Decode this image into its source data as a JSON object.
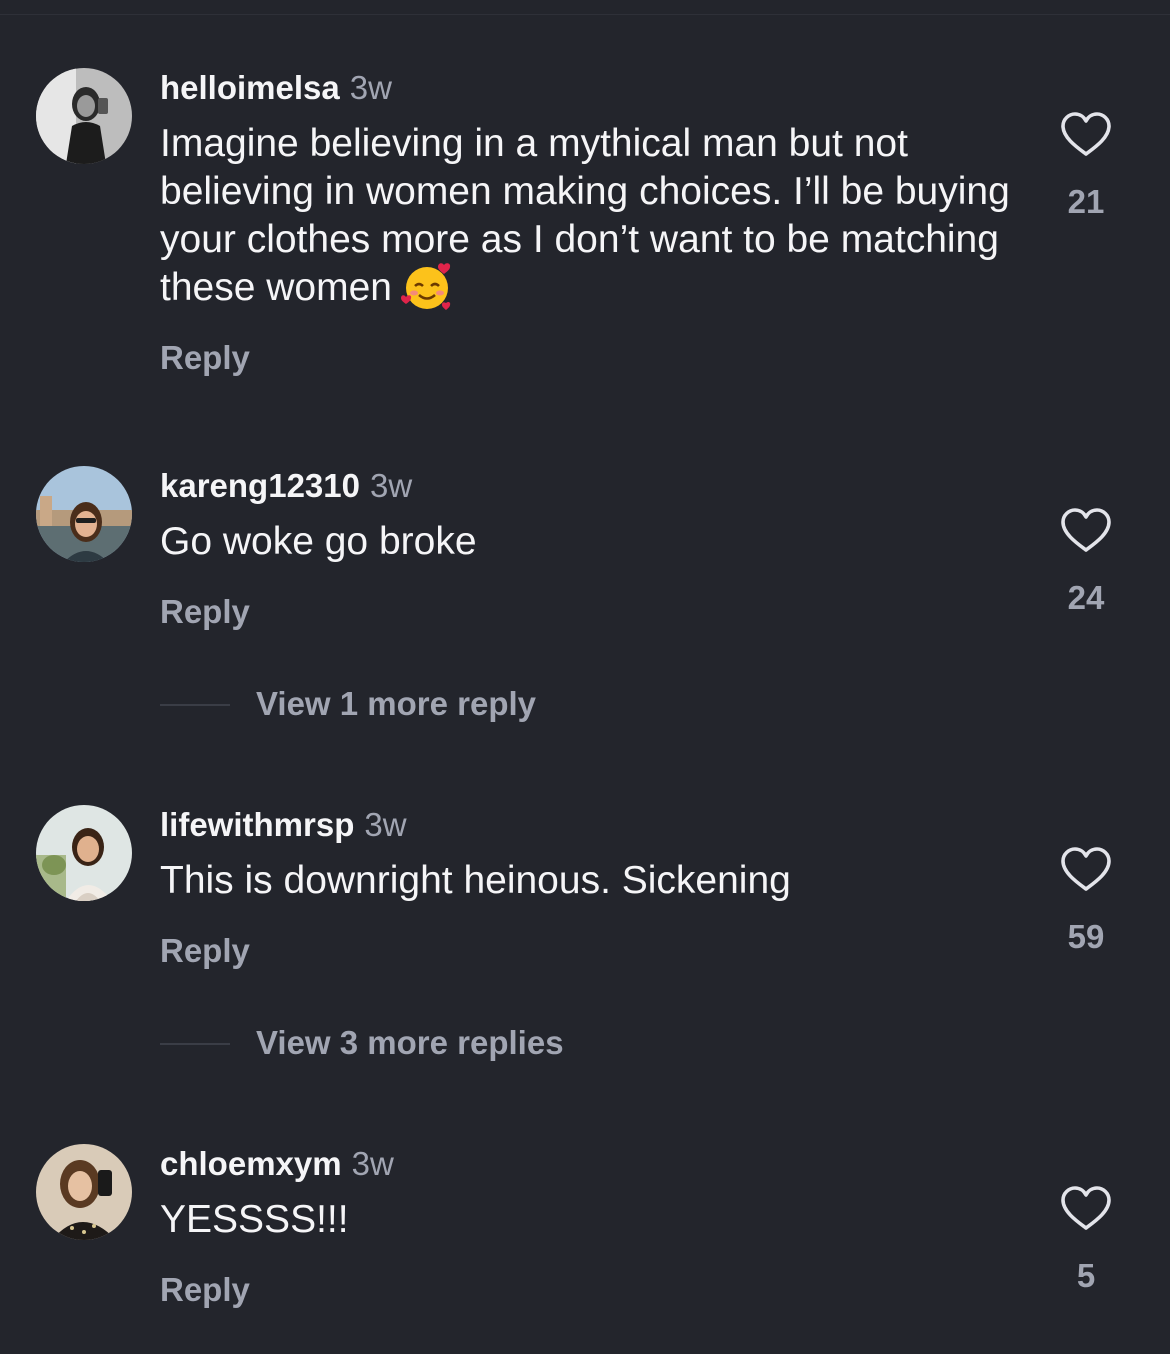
{
  "comments": [
    {
      "username": "helloimelsa",
      "time": "3w",
      "text": "Imagine believing in a mythical man but not believing in women making choices. I’ll be buying your clothes more as I don’t want to be matching these women",
      "emoji": "smiling-face-with-hearts",
      "reply_label": "Reply",
      "likes": "21"
    },
    {
      "username": "kareng12310",
      "time": "3w",
      "text": "Go woke go broke",
      "reply_label": "Reply",
      "likes": "24",
      "view_more": "View 1 more reply"
    },
    {
      "username": "lifewithmrsp",
      "time": "3w",
      "text": "This is downright heinous. Sickening",
      "reply_label": "Reply",
      "likes": "59",
      "view_more": "View 3 more replies"
    },
    {
      "username": "chloemxym",
      "time": "3w",
      "text": "YESSSS!!!",
      "reply_label": "Reply",
      "likes": "5"
    }
  ],
  "colors": {
    "background": "#23252c",
    "primary_text": "#f5f5f7",
    "secondary_text": "#a1a5b2"
  }
}
